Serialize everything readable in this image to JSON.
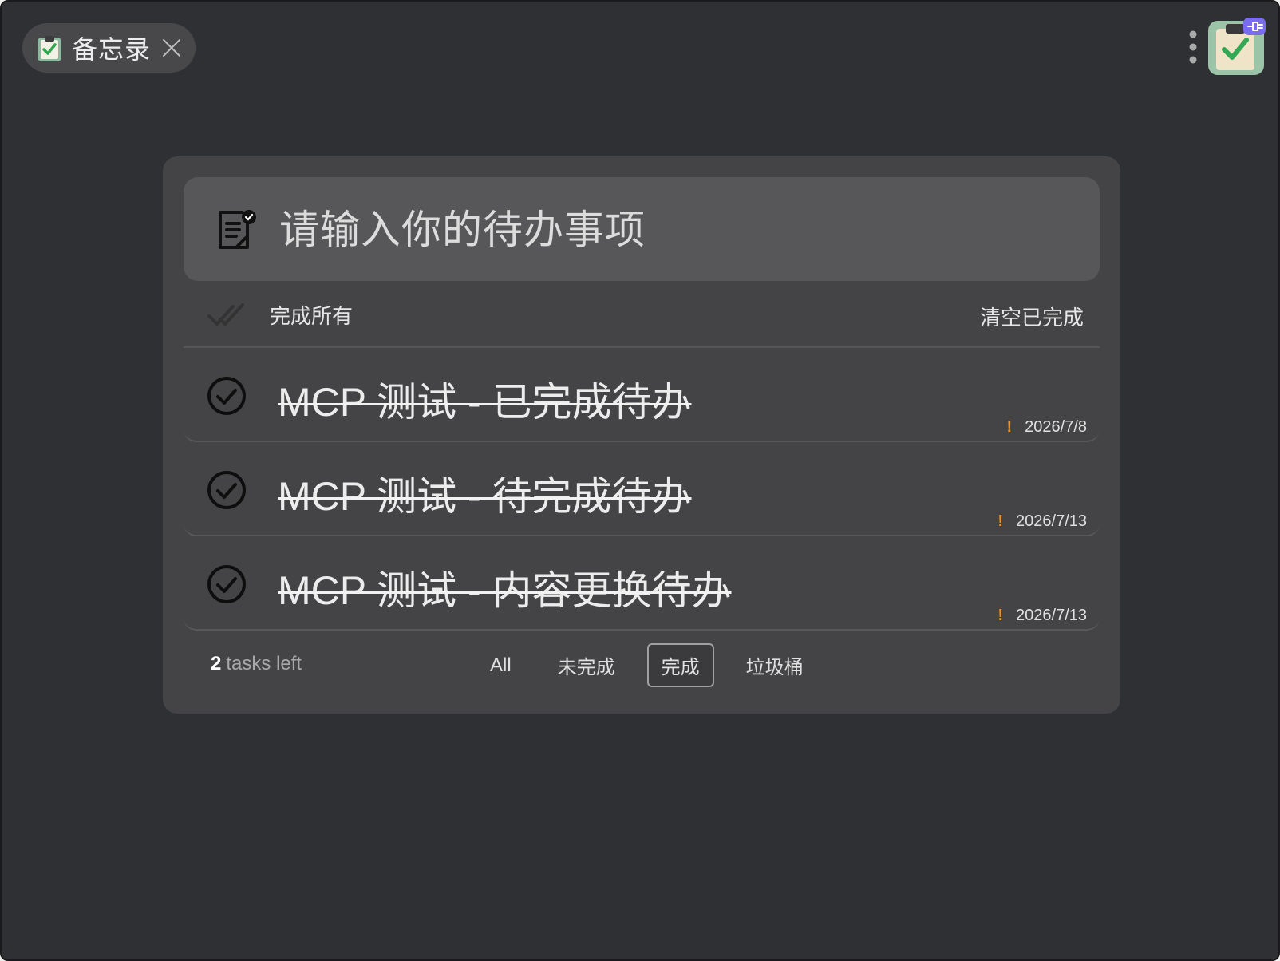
{
  "window": {
    "tab_title": "备忘录",
    "colors": {
      "background": "#2f3033",
      "card": "#444446",
      "input": "#575759",
      "priority": "#f0902a"
    }
  },
  "input": {
    "placeholder": "请输入你的待办事项",
    "icon": "note-check-icon"
  },
  "actions": {
    "complete_all_label": "完成所有",
    "clear_completed_label": "清空已完成"
  },
  "todos": [
    {
      "text": "MCP 测试 - 已完成待办",
      "priority_mark": "!",
      "date": "2026/7/8",
      "completed": true
    },
    {
      "text": "MCP 测试 - 待完成待办",
      "priority_mark": "!",
      "date": "2026/7/13",
      "completed": true
    },
    {
      "text": "MCP 测试 - 内容更换待办",
      "priority_mark": "!",
      "date": "2026/7/13",
      "completed": true
    }
  ],
  "footer": {
    "tasks_left_count": "2",
    "tasks_left_label": "tasks left",
    "filters": [
      {
        "label": "All",
        "active": false
      },
      {
        "label": "未完成",
        "active": false
      },
      {
        "label": "完成",
        "active": true
      },
      {
        "label": "垃圾桶",
        "active": false
      }
    ]
  }
}
